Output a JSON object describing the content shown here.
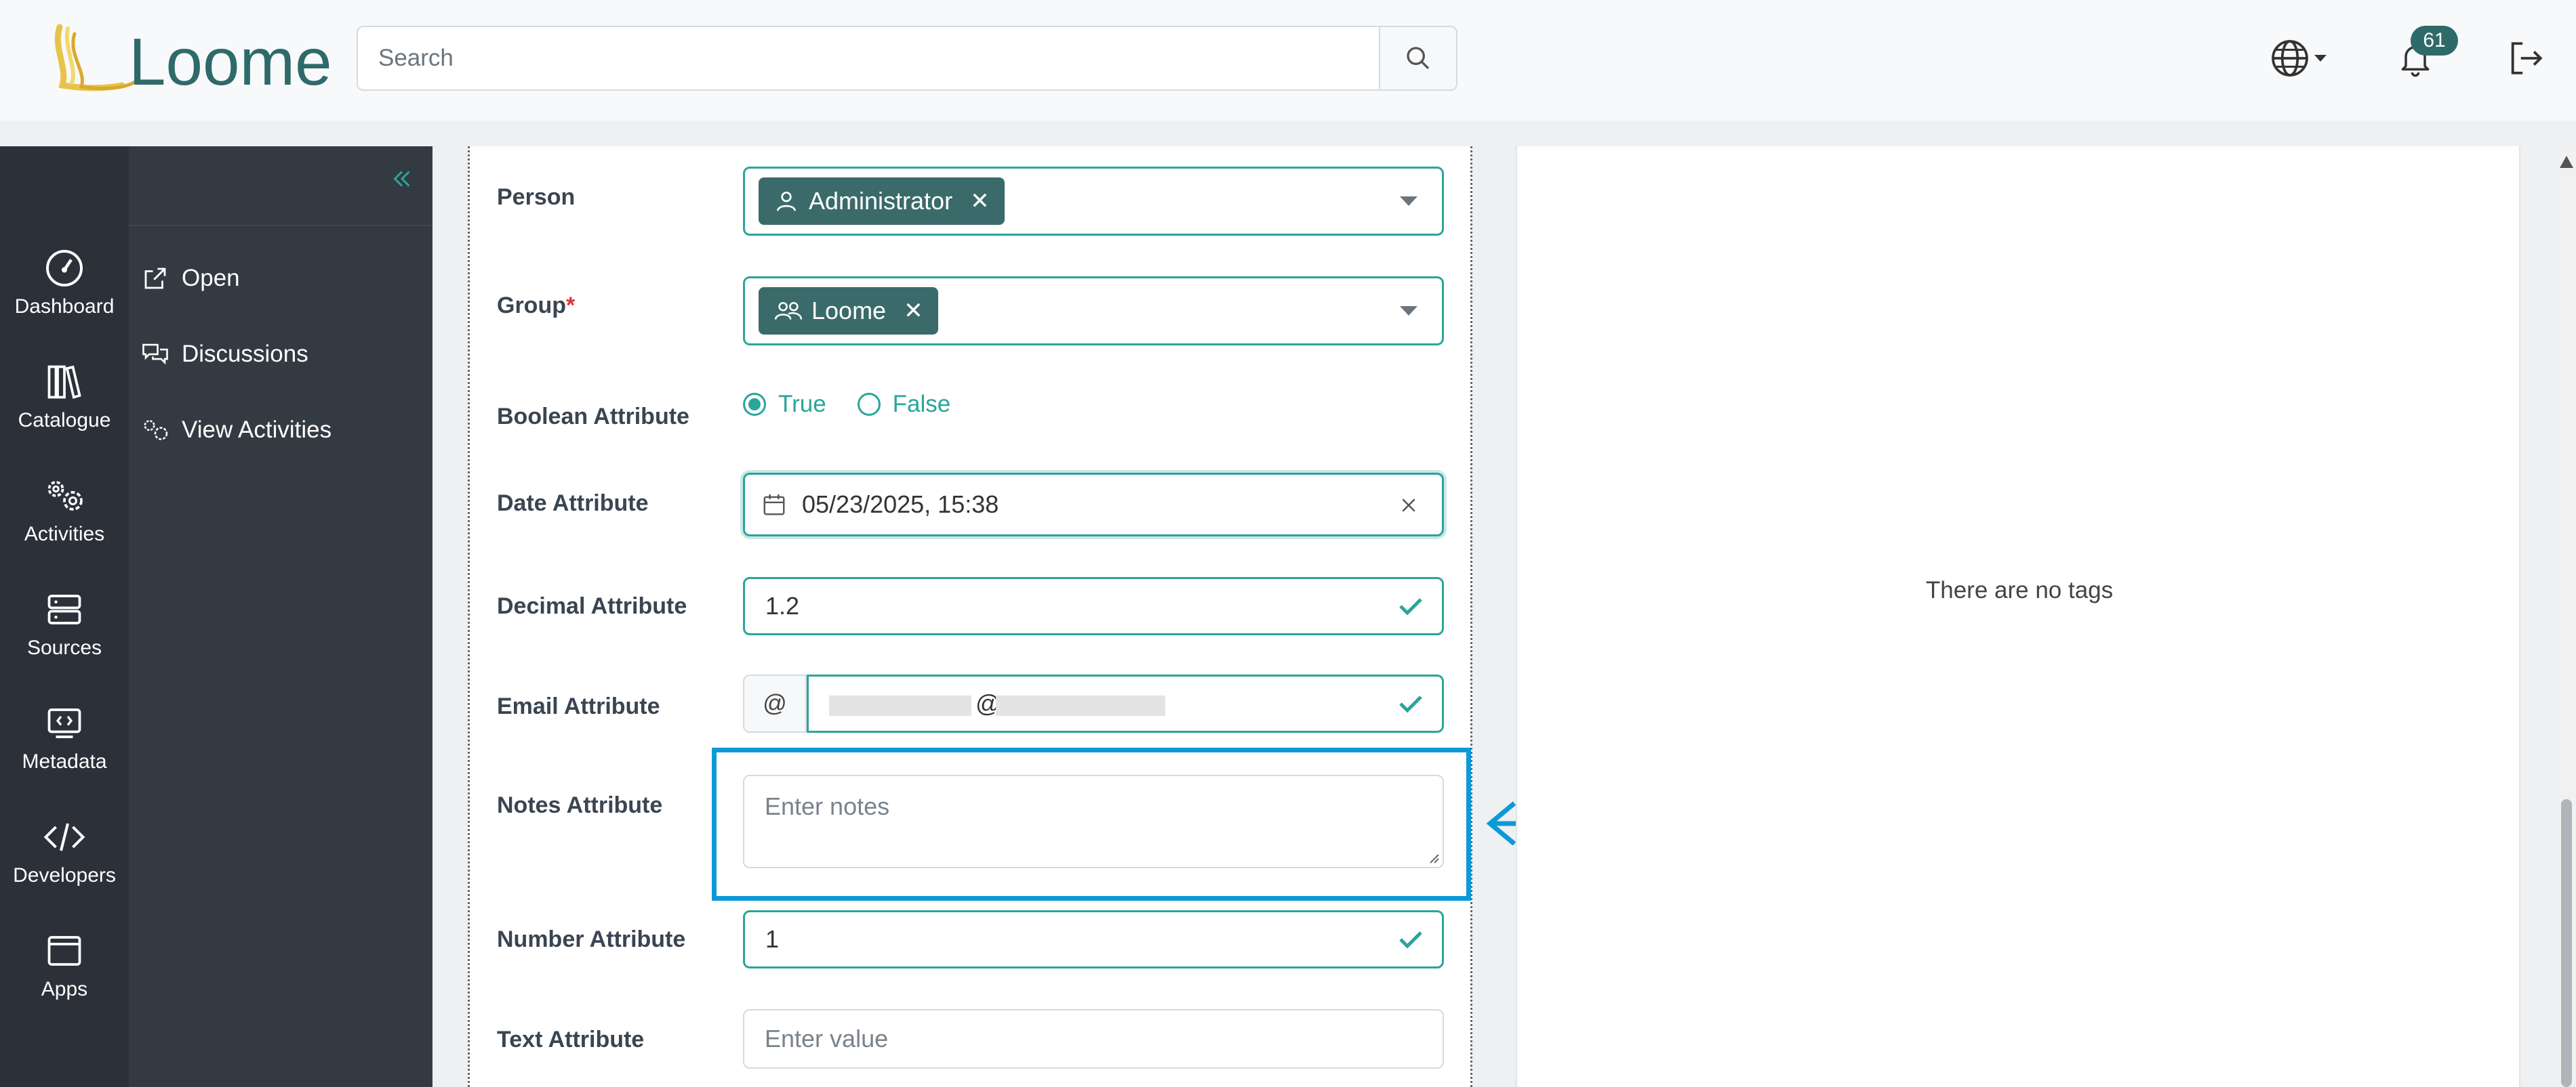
{
  "header": {
    "logo_text": "Loome",
    "search_placeholder": "Search",
    "notification_count": "61",
    "icons": [
      "search-icon",
      "globe-icon",
      "bell-icon",
      "logout-icon"
    ]
  },
  "nav": {
    "items": [
      {
        "label": "Dashboard",
        "icon": "dashboard-icon"
      },
      {
        "label": "Catalogue",
        "icon": "books-icon"
      },
      {
        "label": "Activities",
        "icon": "gears-icon"
      },
      {
        "label": "Sources",
        "icon": "server-icon"
      },
      {
        "label": "Metadata",
        "icon": "code-screen-icon"
      },
      {
        "label": "Developers",
        "icon": "code-icon"
      },
      {
        "label": "Apps",
        "icon": "window-icon"
      }
    ]
  },
  "submenu": {
    "items": [
      {
        "label": "Open",
        "icon": "external-link-icon"
      },
      {
        "label": "Discussions",
        "icon": "chat-icon"
      },
      {
        "label": "View Activities",
        "icon": "gears-icon"
      }
    ]
  },
  "form": {
    "person": {
      "label": "Person",
      "chip": "Administrator"
    },
    "group": {
      "label": "Group",
      "required_mark": "*",
      "chip": "Loome"
    },
    "boolean": {
      "label": "Boolean Attribute",
      "options": [
        "True",
        "False"
      ],
      "selected": "True"
    },
    "date": {
      "label": "Date Attribute",
      "value": "05/23/2025, 15:38"
    },
    "decimal": {
      "label": "Decimal Attribute",
      "value": "1.2"
    },
    "email": {
      "label": "Email Attribute",
      "prefix": "@",
      "value_separator": "@"
    },
    "notes": {
      "label": "Notes Attribute",
      "placeholder": "Enter notes"
    },
    "number": {
      "label": "Number Attribute",
      "value": "1"
    },
    "text": {
      "label": "Text Attribute",
      "placeholder": "Enter value"
    }
  },
  "tags": {
    "empty_message": "There are no tags"
  },
  "colors": {
    "accent": "#2aa59a",
    "chip": "#3a6b6a",
    "highlight": "#0d99d8",
    "sidebar": "#2c3139"
  }
}
